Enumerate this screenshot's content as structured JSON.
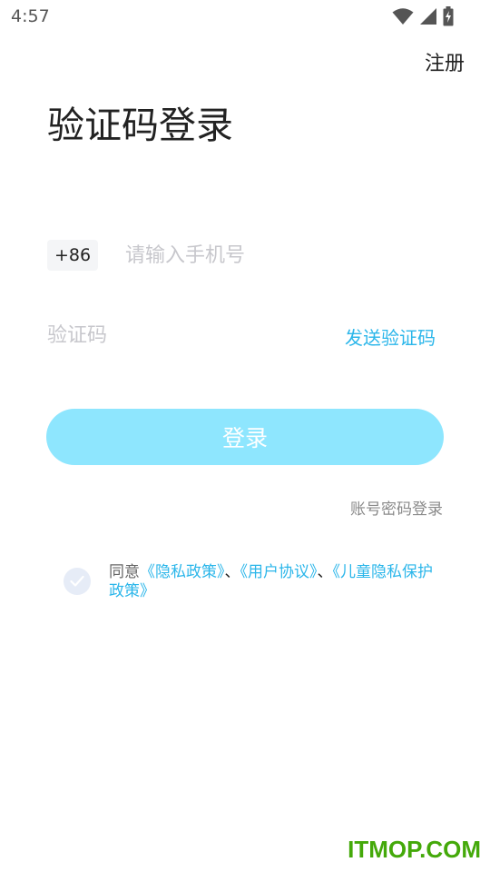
{
  "status_bar": {
    "time": "4:57",
    "icons": [
      "wifi-icon",
      "signal-icon",
      "battery-charging-icon"
    ]
  },
  "header": {
    "register_label": "注册"
  },
  "page": {
    "title": "验证码登录"
  },
  "phone": {
    "country_code": "+86",
    "placeholder": "请输入手机号",
    "value": ""
  },
  "verification": {
    "placeholder": "验证码",
    "value": "",
    "send_label": "发送验证码"
  },
  "login_button": {
    "label": "登录"
  },
  "password_login": {
    "label": "账号密码登录"
  },
  "agreement": {
    "prefix": "同意",
    "privacy_policy": "《隐私政策》",
    "separator_1": "、",
    "user_agreement": "《用户协议》",
    "separator_2": "、",
    "children_privacy": "《儿童隐私保护政策》",
    "checked": false
  },
  "watermark": {
    "text": "ITMOP.COM"
  },
  "colors": {
    "accent": "#2bb6ea",
    "button_bg": "#8ee6fe",
    "watermark": "#44a90a"
  }
}
